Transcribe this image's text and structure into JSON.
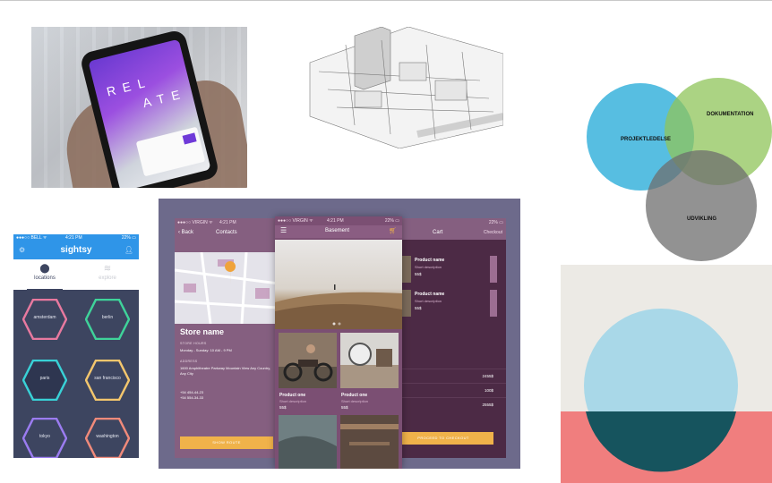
{
  "photo_relate": {
    "text_line1": "REL",
    "text_line2": "ATE"
  },
  "venn": {
    "circles": [
      {
        "label": "PROJEKTLEDELSE",
        "color": "#3ab3dc"
      },
      {
        "label": "DOKUMENTATION",
        "color": "#8fc45a"
      },
      {
        "label": "UDVIKLING",
        "color": "#6e6e6e"
      }
    ]
  },
  "sightsy": {
    "status_left": "●●●○○ BELL ᯤ",
    "status_time": "4:21 PM",
    "status_right": "22% ▭",
    "app_title": "sightsy",
    "tabs": [
      {
        "label": "locations",
        "icon": "pin-icon",
        "active": true
      },
      {
        "label": "explore",
        "icon": "layers-icon",
        "active": false
      }
    ],
    "cities": [
      {
        "name": "amsterdam",
        "color": "#e8799f"
      },
      {
        "name": "berlin",
        "color": "#3fd39a"
      },
      {
        "name": "paris",
        "color": "#39d1d6"
      },
      {
        "name": "san francisco",
        "color": "#f3c66d"
      },
      {
        "name": "tokyo",
        "color": "#9b7cf0"
      },
      {
        "name": "washington",
        "color": "#f08a7a"
      }
    ]
  },
  "contacts_screen": {
    "status_left": "●●●○○ VIRGIN ᯤ",
    "status_time": "4:21 PM",
    "back": "‹ Back",
    "title": "Contacts",
    "store_name": "Store name",
    "hours_label": "STORE HOURS",
    "hours": "Monday - Sunday: 10 AM - 9 PM",
    "address_label": "ADDRESS",
    "address": "1600 Amphitheatre Parkway Mountain View Any Country, Any City",
    "phones": [
      "+54 454-44-23",
      "+54 554-34-33"
    ],
    "button": "SHOW ROUTE"
  },
  "basement_screen": {
    "status_left": "●●●○○ VIRGIN ᯤ",
    "status_time": "4:21 PM",
    "status_right": "22% ▭",
    "title": "Basement",
    "products": [
      {
        "name": "Product one",
        "desc": "Short description",
        "price": "55$"
      },
      {
        "name": "Product one",
        "desc": "Short description",
        "price": "55$"
      }
    ]
  },
  "cart_screen": {
    "status_right": "22% ▭",
    "title": "Cart",
    "checkout": "Checkout",
    "items": [
      {
        "name": "Product name",
        "desc": "Short description",
        "price": "55$"
      },
      {
        "name": "Product name",
        "desc": "Short description",
        "price": "55$"
      }
    ],
    "totals": [
      {
        "label": "",
        "value": "2455$"
      },
      {
        "label": "",
        "value": "100$"
      },
      {
        "label": "",
        "value": "2555$"
      }
    ],
    "button": "PROCEED TO CHECKOUT"
  }
}
